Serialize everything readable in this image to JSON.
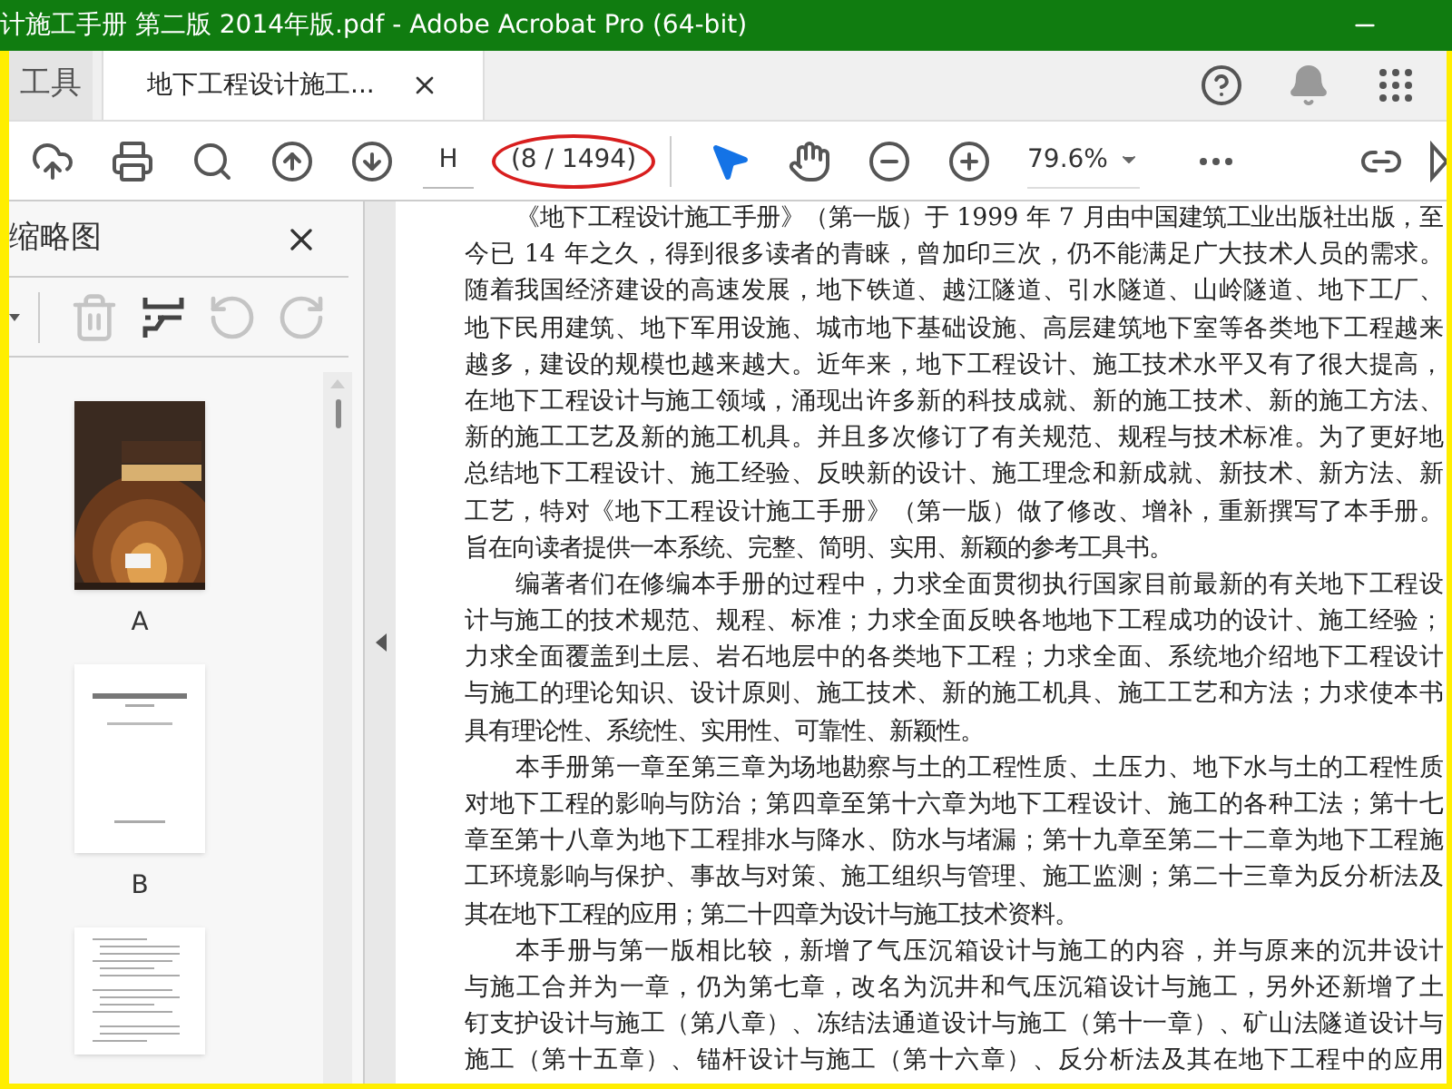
{
  "window": {
    "title": "计施工手册 第二版 2014年版.pdf - Adobe Acrobat Pro (64-bit)"
  },
  "tabs": [
    {
      "label": "工具",
      "selected": false,
      "closable": false
    },
    {
      "label": "地下工程设计施工...",
      "selected": true,
      "closable": true
    }
  ],
  "toolbar": {
    "page_field": "H",
    "page_count": "(8 / 1494)",
    "zoom": "79.6%",
    "tools": [
      {
        "kind": "select",
        "selected": true
      },
      {
        "kind": "hand",
        "selected": false
      }
    ]
  },
  "thumbnails_panel": {
    "title": "缩略图",
    "tools": [
      {
        "kind": "delete",
        "disabled": true
      },
      {
        "kind": "extract",
        "disabled": false
      },
      {
        "kind": "rotate_left",
        "disabled": true
      },
      {
        "kind": "rotate_right",
        "disabled": true
      }
    ],
    "pages": [
      {
        "kind": "cover",
        "label": "A"
      },
      {
        "kind": "title",
        "label": "B"
      },
      {
        "kind": "text"
      }
    ]
  },
  "document": {
    "paragraphs": [
      {
        "lines": [
          "《地下工程设计施工手册》（第一版）于 1999 年 7 月由中国建筑工业出版社出版，至",
          "今已 14 年之久，得到很多读者的青睐，曾加印三次，仍不能满足广大技术人员的需求。",
          "随着我国经济建设的高速发展，地下铁道、越江隧道、引水隧道、山岭隧道、地下工厂、",
          "地下民用建筑、地下军用设施、城市地下基础设施、高层建筑地下室等各类地下工程越来",
          "越多，建设的规模也越来越大。近年来，地下工程设计、施工技术水平又有了很大提高，",
          "在地下工程设计与施工领域，涌现出许多新的科技成就、新的施工技术、新的施工方法、",
          "新的施工工艺及新的施工机具。并且多次修订了有关规范、规程与技术标准。为了更好地",
          "总结地下工程设计、施工经验、反映新的设计、施工理念和新成就、新技术、新方法、新",
          "工艺，特对《地下工程设计施工手册》（第一版）做了修改、增补，重新撰写了本手册。",
          "旨在向读者提供一本系统、完整、简明、实用、新颖的参考工具书。"
        ]
      },
      {
        "lines": [
          "编著者们在修编本手册的过程中，力求全面贯彻执行国家目前最新的有关地下工程设",
          "计与施工的技术规范、规程、标准；力求全面反映各地地下工程成功的设计、施工经验；",
          "力求全面覆盖到土层、岩石地层中的各类地下工程；力求全面、系统地介绍地下工程设计",
          "与施工的理论知识、设计原则、施工技术、新的施工机具、施工工艺和方法；力求使本书",
          "具有理论性、系统性、实用性、可靠性、新颖性。"
        ]
      },
      {
        "lines": [
          "本手册第一章至第三章为场地勘察与土的工程性质、土压力、地下水与土的工程性质",
          "对地下工程的影响与防治；第四章至第十六章为地下工程设计、施工的各种工法；第十七",
          "章至第十八章为地下工程排水与降水、防水与堵漏；第十九章至第二十二章为地下工程施",
          "工环境影响与保护、事故与对策、施工组织与管理、施工监测；第二十三章为反分析法及",
          "其在地下工程的应用；第二十四章为设计与施工技术资料。"
        ]
      },
      {
        "lines": [
          "本手册与第一版相比较，新增了气压沉箱设计与施工的内容，并与原来的沉井设计",
          "与施工合并为一章，仍为第七章，改名为沉井和气压沉箱设计与施工，另外还新增了土",
          "钉支护设计与施工（第八章）、冻结法通道设计与施工（第十一章）、矿山法隧道设计与",
          "施工（第十五章）、锚杆设计与施工（第十六章）、反分析法及其在地下工程中的应用"
        ]
      }
    ]
  }
}
